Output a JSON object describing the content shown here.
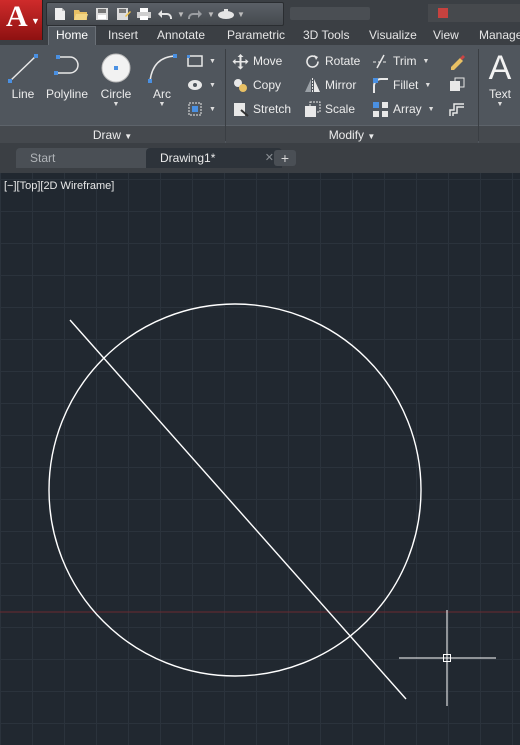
{
  "app": {
    "logo_letter": "A",
    "qat_icons": [
      "new-file-icon",
      "open-folder-icon",
      "save-icon",
      "save-as-icon",
      "print-icon",
      "undo-icon",
      "redo-icon",
      "workspace-icon",
      "customize-icon"
    ]
  },
  "ribbon_tabs": [
    "Home",
    "Insert",
    "Annotate",
    "Parametric",
    "3D Tools",
    "Visualize",
    "View",
    "Manage"
  ],
  "active_tab": "Home",
  "draw_panel": {
    "title": "Draw",
    "tools": [
      "Line",
      "Polyline",
      "Circle",
      "Arc"
    ]
  },
  "modify_panel": {
    "title": "Modify",
    "tools": {
      "move": "Move",
      "rotate": "Rotate",
      "trim": "Trim",
      "copy": "Copy",
      "mirror": "Mirror",
      "fillet": "Fillet",
      "stretch": "Stretch",
      "scale": "Scale",
      "array": "Array"
    }
  },
  "annotation_panel": {
    "text_tool": "Text"
  },
  "document_tabs": [
    {
      "label": "Start",
      "active": false
    },
    {
      "label": "Drawing1*",
      "active": true
    }
  ],
  "viewport": {
    "label": "[−][Top][2D Wireframe]"
  },
  "colors": {
    "accent_app": "#c0201f",
    "canvas_bg": "#212830",
    "grid": "#2b333c",
    "geometry": "#ffffff",
    "x_axis": "#7a2a30"
  },
  "drawing": {
    "objects": [
      "circle",
      "line",
      "crosshair-cursor"
    ]
  }
}
